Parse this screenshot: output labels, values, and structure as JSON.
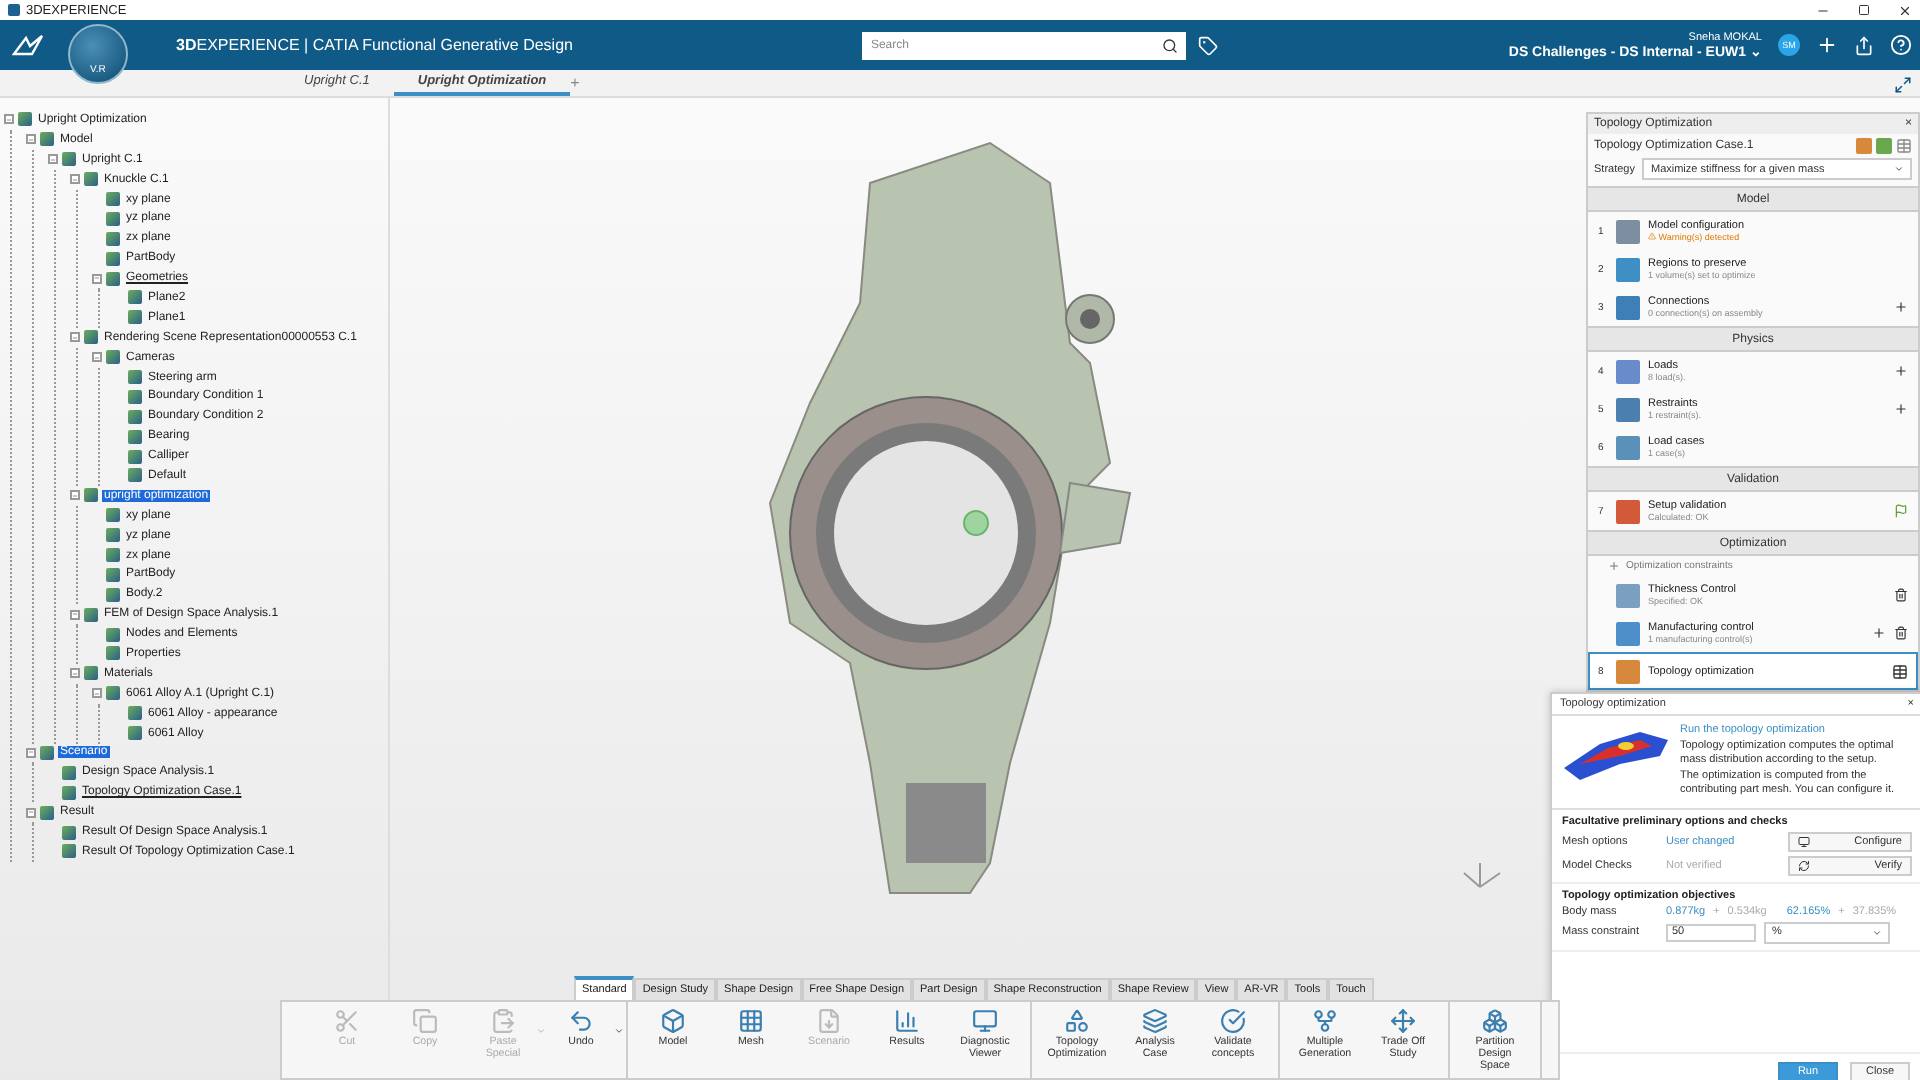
{
  "window": {
    "title": "3DEXPERIENCE"
  },
  "top_bar": {
    "compass_label": "V.R",
    "brand": "3D",
    "product": "EXPERIENCE | CATIA",
    "app": "Functional Generative Design",
    "search": {
      "placeholder": "Search"
    },
    "user": "Sneha MOKAL",
    "tenant": "DS Challenges - DS Internal - EUW1",
    "tenant_caret": "⌄",
    "avatar": "SM"
  },
  "tabs": [
    {
      "label": "Upright C.1",
      "selected": false
    },
    {
      "label": "Upright Optimization",
      "selected": true
    }
  ],
  "new_tab": "+",
  "tree": [
    {
      "label": "Upright Optimization",
      "selected": false,
      "underlined": false,
      "children": [
        {
          "label": "Model",
          "selected": false,
          "underlined": false,
          "children": [
            {
              "label": "Upright C.1",
              "selected": false,
              "underlined": false,
              "children": [
                {
                  "label": "Knuckle C.1",
                  "selected": false,
                  "underlined": false,
                  "children": [
                    {
                      "label": "xy plane",
                      "selected": false,
                      "underlined": false
                    },
                    {
                      "label": "yz plane",
                      "selected": false,
                      "underlined": false
                    },
                    {
                      "label": "zx plane",
                      "selected": false,
                      "underlined": false
                    },
                    {
                      "label": "PartBody",
                      "selected": false,
                      "underlined": false
                    },
                    {
                      "label": "Geometries",
                      "selected": false,
                      "underlined": true,
                      "children": [
                        {
                          "label": "Plane2",
                          "selected": false,
                          "underlined": false
                        },
                        {
                          "label": "Plane1",
                          "selected": false,
                          "underlined": false
                        }
                      ]
                    }
                  ]
                },
                {
                  "label": "Rendering Scene Representation00000553 C.1",
                  "selected": false,
                  "underlined": false,
                  "children": [
                    {
                      "label": "Cameras",
                      "selected": false,
                      "underlined": false,
                      "children": [
                        {
                          "label": "Steering arm",
                          "selected": false,
                          "underlined": false
                        },
                        {
                          "label": "Boundary Condition 1",
                          "selected": false,
                          "underlined": false
                        },
                        {
                          "label": "Boundary Condition 2",
                          "selected": false,
                          "underlined": false
                        },
                        {
                          "label": "Bearing",
                          "selected": false,
                          "underlined": false
                        },
                        {
                          "label": "Calliper",
                          "selected": false,
                          "underlined": false
                        },
                        {
                          "label": "Default",
                          "selected": false,
                          "underlined": false
                        }
                      ]
                    }
                  ]
                },
                {
                  "label": "upright optimization",
                  "selected": true,
                  "underlined": false,
                  "children": [
                    {
                      "label": "xy plane",
                      "selected": false,
                      "underlined": false
                    },
                    {
                      "label": "yz plane",
                      "selected": false,
                      "underlined": false
                    },
                    {
                      "label": "zx plane",
                      "selected": false,
                      "underlined": false
                    },
                    {
                      "label": "PartBody",
                      "selected": false,
                      "underlined": false
                    },
                    {
                      "label": "Body.2",
                      "selected": false,
                      "underlined": false
                    }
                  ]
                },
                {
                  "label": "FEM of Design Space Analysis.1",
                  "selected": false,
                  "underlined": false,
                  "children": [
                    {
                      "label": "Nodes and Elements",
                      "selected": false,
                      "underlined": false
                    },
                    {
                      "label": "Properties",
                      "selected": false,
                      "underlined": false
                    }
                  ]
                },
                {
                  "label": "Materials",
                  "selected": false,
                  "underlined": false,
                  "children": [
                    {
                      "label": "6061 Alloy A.1 (Upright C.1)",
                      "selected": false,
                      "underlined": false,
                      "children": [
                        {
                          "label": "6061 Alloy - appearance",
                          "selected": false,
                          "underlined": false
                        },
                        {
                          "label": "6061 Alloy",
                          "selected": false,
                          "underlined": false
                        }
                      ]
                    }
                  ]
                }
              ]
            }
          ]
        },
        {
          "label": "Scenario",
          "selected": true,
          "underlined": false,
          "children": [
            {
              "label": "Design Space Analysis.1",
              "selected": false,
              "underlined": false
            },
            {
              "label": "Topology Optimization Case.1",
              "selected": false,
              "underlined": true
            }
          ]
        },
        {
          "label": "Result",
          "selected": false,
          "underlined": false,
          "children": [
            {
              "label": "Result Of Design Space Analysis.1",
              "selected": false,
              "underlined": false
            },
            {
              "label": "Result Of Topology Optimization Case.1",
              "selected": false,
              "underlined": false
            }
          ]
        }
      ]
    }
  ],
  "panel": {
    "tab": "Topology Optimization",
    "close": "×",
    "case": "Topology Optimization Case.1",
    "strategy_label": "Strategy",
    "strategy": "Maximize stiffness for a given mass",
    "sections": [
      {
        "title": "Model",
        "steps": [
          {
            "number": "1",
            "title": "Model configuration",
            "status": "Warning(s) detected",
            "warning": true,
            "selected": false,
            "add": false,
            "delete": false,
            "run": false,
            "table": false
          },
          {
            "number": "2",
            "title": "Regions to preserve",
            "status": "1 volume(s) set to optimize",
            "warning": false,
            "selected": false,
            "add": false,
            "delete": false,
            "run": false,
            "table": false
          },
          {
            "number": "3",
            "title": "Connections",
            "status": "0 connection(s) on assembly",
            "warning": false,
            "selected": false,
            "add": true,
            "delete": false,
            "run": false,
            "table": false
          }
        ]
      },
      {
        "title": "Physics",
        "steps": [
          {
            "number": "4",
            "title": "Loads",
            "status": "8 load(s).",
            "warning": false,
            "selected": false,
            "add": true,
            "delete": false,
            "run": false,
            "table": false
          },
          {
            "number": "5",
            "title": "Restraints",
            "status": "1 restraint(s).",
            "warning": false,
            "selected": false,
            "add": true,
            "delete": false,
            "run": false,
            "table": false
          },
          {
            "number": "6",
            "title": "Load cases",
            "status": "1 case(s)",
            "warning": false,
            "selected": false,
            "add": false,
            "delete": false,
            "run": false,
            "table": false
          }
        ]
      },
      {
        "title": "Validation",
        "steps": [
          {
            "number": "7",
            "title": "Setup validation",
            "status": "Calculated: OK",
            "warning": false,
            "selected": false,
            "add": false,
            "delete": false,
            "run": true,
            "table": false
          }
        ]
      },
      {
        "title": "Optimization",
        "link": "Optimization constraints",
        "steps": [
          {
            "title": "Thickness Control",
            "status": "Specified: OK",
            "warning": false,
            "selected": false,
            "add": false,
            "delete": true,
            "run": false,
            "table": false
          },
          {
            "title": "Manufacturing control",
            "status": "1 manufacturing control(s)",
            "warning": false,
            "selected": false,
            "add": true,
            "delete": true,
            "run": false,
            "table": false
          },
          {
            "number": "8",
            "title": "Topology optimization",
            "selected": true,
            "add": false,
            "delete": false,
            "run": false,
            "table": true
          }
        ]
      }
    ]
  },
  "popup": {
    "title": "Topology optimization",
    "close": "×",
    "link": "Run the topology optimization",
    "text": [
      "Topology optimization computes the optimal mass distribution according to the setup.",
      "The optimization is computed from the contributing part mesh. You can configure it."
    ],
    "options_title": "Facultative preliminary options and checks",
    "options": [
      {
        "label": "Mesh options",
        "value": "User changed",
        "link": true,
        "button": "Configure"
      },
      {
        "label": "Model Checks",
        "value": "Not verified",
        "link": false,
        "button": "Verify"
      }
    ],
    "objectives_title": "Topology optimization objectives",
    "body_mass": {
      "label": "Body mass",
      "mass_kept": "0.877kg",
      "plus_1": "+",
      "mass_removed": "0.534kg",
      "pct_kept": "62.165%",
      "plus_2": "+",
      "pct_removed": "37.835%"
    },
    "mass_constraint": {
      "label": "Mass constraint",
      "value": "50",
      "unit": "%"
    },
    "buttons": [
      "Run",
      "Close"
    ]
  },
  "ribbon": {
    "tabs": [
      {
        "label": "Standard",
        "selected": true
      },
      {
        "label": "Design Study",
        "selected": false
      },
      {
        "label": "Shape Design",
        "selected": false
      },
      {
        "label": "Free Shape Design",
        "selected": false
      },
      {
        "label": "Part Design",
        "selected": false
      },
      {
        "label": "Shape Reconstruction",
        "selected": false
      },
      {
        "label": "Shape Review",
        "selected": false
      },
      {
        "label": "View",
        "selected": false
      },
      {
        "label": "AR-VR",
        "selected": false
      },
      {
        "label": "Tools",
        "selected": false
      },
      {
        "label": "Touch",
        "selected": false
      }
    ],
    "groups": [
      [
        {
          "label": "Cut",
          "disabled": true,
          "dropdown": false
        },
        {
          "label": "Copy",
          "disabled": true,
          "dropdown": false
        },
        {
          "label": "Paste Special",
          "disabled": true,
          "dropdown": true
        },
        {
          "label": "Undo",
          "disabled": false,
          "dropdown": true
        }
      ],
      [
        {
          "label": "Model",
          "disabled": false,
          "dropdown": false
        },
        {
          "label": "Mesh",
          "disabled": false,
          "dropdown": false
        },
        {
          "label": "Scenario",
          "disabled": true,
          "dropdown": false
        },
        {
          "label": "Results",
          "disabled": false,
          "dropdown": false
        },
        {
          "label": "Diagnostic Viewer",
          "disabled": false,
          "dropdown": false
        }
      ],
      [
        {
          "label": "Topology Optimization",
          "disabled": false,
          "dropdown": false
        },
        {
          "label": "Analysis Case",
          "disabled": false,
          "dropdown": false
        },
        {
          "label": "Validate concepts",
          "disabled": false,
          "dropdown": false
        }
      ],
      [
        {
          "label": "Multiple Generation",
          "disabled": false,
          "dropdown": false
        },
        {
          "label": "Trade Off Study",
          "disabled": false,
          "dropdown": false
        }
      ],
      [
        {
          "label": "Partition Design Space",
          "disabled": false,
          "dropdown": false
        }
      ]
    ]
  }
}
